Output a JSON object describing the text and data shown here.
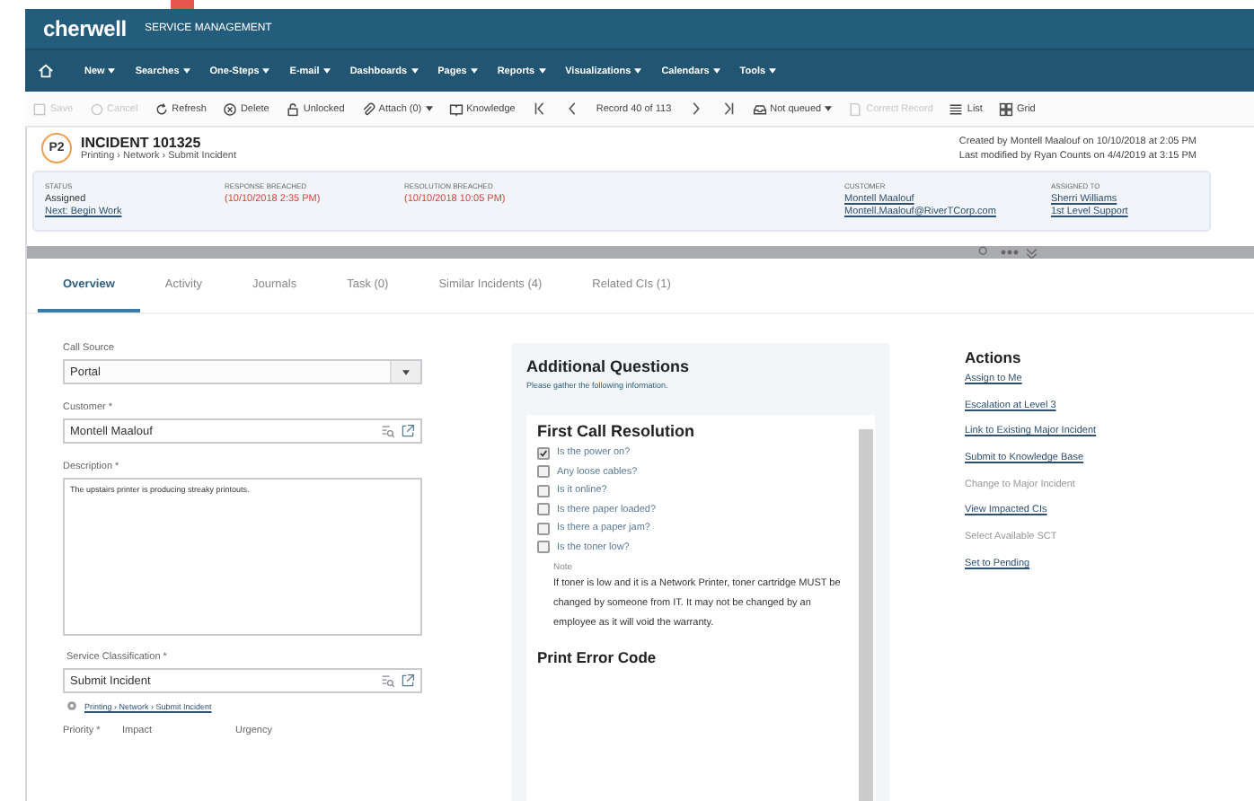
{
  "brand": {
    "logo": "cherwell",
    "product": "SERVICE MANAGEMENT"
  },
  "nav": [
    {
      "label": "New",
      "dropdown": true
    },
    {
      "label": "Searches",
      "dropdown": true
    },
    {
      "label": "One-Steps",
      "dropdown": true
    },
    {
      "label": "E-mail",
      "dropdown": true
    },
    {
      "label": "Dashboards",
      "dropdown": true
    },
    {
      "label": "Pages",
      "dropdown": true
    },
    {
      "label": "Reports",
      "dropdown": true
    },
    {
      "label": "Visualizations",
      "dropdown": true
    },
    {
      "label": "Calendars",
      "dropdown": true
    },
    {
      "label": "Tools",
      "dropdown": true
    }
  ],
  "toolbar": [
    {
      "kind": "button",
      "label": "Save",
      "disabled": true
    },
    {
      "kind": "button",
      "label": "Cancel",
      "disabled": true
    },
    {
      "kind": "button",
      "label": "Refresh",
      "disabled": false
    },
    {
      "kind": "button",
      "label": "Delete",
      "disabled": false
    },
    {
      "kind": "button",
      "label": "Unlocked",
      "disabled": false
    },
    {
      "kind": "button",
      "label": "Attach (0)",
      "disabled": false,
      "dropdown": true
    },
    {
      "kind": "button",
      "label": "Knowledge",
      "disabled": false
    },
    {
      "kind": "nav"
    },
    {
      "kind": "nav"
    },
    {
      "kind": "text",
      "label": "Record 40 of 113"
    },
    {
      "kind": "nav"
    },
    {
      "kind": "nav"
    },
    {
      "kind": "button",
      "label": "Not queued",
      "disabled": false,
      "dropdown": true
    },
    {
      "kind": "button",
      "label": "Correct Record",
      "disabled": true
    },
    {
      "kind": "button",
      "label": "List",
      "disabled": false
    },
    {
      "kind": "button",
      "label": "Grid",
      "disabled": false
    }
  ],
  "incident": {
    "priority": "P2",
    "title": "INCIDENT 101325",
    "breadcrumb": "Printing › Network › Submit Incident",
    "created": "Created by Montell Maalouf on 10/10/2018 at 2:05 PM",
    "modified": "Last modified by Ryan Counts on 4/4/2019 at 3:15 PM"
  },
  "summary": [
    {
      "label": "STATUS",
      "values": [
        {
          "kind": "text",
          "text": "Assigned"
        },
        {
          "kind": "link",
          "text": "Next: Begin Work"
        }
      ]
    },
    {
      "label": "RESPONSE BREACHED",
      "values": [
        {
          "kind": "alert",
          "text": "(10/10/2018 2:35 PM)"
        }
      ]
    },
    {
      "label": "RESOLUTION BREACHED",
      "values": [
        {
          "kind": "alert",
          "text": "(10/10/2018 10:05 PM)"
        }
      ]
    },
    {
      "label": "CUSTOMER",
      "values": [
        {
          "kind": "link",
          "text": "Montell Maalouf"
        },
        {
          "kind": "link",
          "text": "Montell.Maalouf@RiverTCorp.com"
        }
      ]
    },
    {
      "label": "ASSIGNED TO",
      "values": [
        {
          "kind": "link",
          "text": "Sherri Williams"
        },
        {
          "kind": "link",
          "text": "1st Level Support"
        }
      ]
    }
  ],
  "tabs": [
    {
      "label": "Overview",
      "selected": true
    },
    {
      "label": "Activity",
      "selected": false
    },
    {
      "label": "Journals",
      "selected": false
    },
    {
      "label": "Task (0)",
      "selected": false
    },
    {
      "label": "Similar Incidents (4)",
      "selected": false
    },
    {
      "label": "Related CIs (1)",
      "selected": false
    }
  ],
  "form": {
    "call_source": {
      "label": "Call Source",
      "value": "Portal"
    },
    "customer": {
      "label": "Customer *",
      "value": "Montell Maalouf"
    },
    "description": {
      "label": "Description *",
      "value": "The upstairs printer is producing streaky printouts."
    },
    "service_classification": {
      "label": "Service Classification *",
      "value": "Submit Incident",
      "link": "Printing › Network › Submit Incident"
    },
    "bottom_labels": [
      "Priority *",
      "Impact",
      "Urgency"
    ]
  },
  "questions": {
    "title": "Additional Questions",
    "subtitle": "Please gather the following information.",
    "section": "First Call Resolution",
    "items": [
      {
        "label": "Is the power on?",
        "checked": true
      },
      {
        "label": "Any loose cables?",
        "checked": false
      },
      {
        "label": "Is it online?",
        "checked": false
      },
      {
        "label": "Is there paper loaded?",
        "checked": false
      },
      {
        "label": "Is there a paper jam?",
        "checked": false
      },
      {
        "label": "Is the toner low?",
        "checked": false
      }
    ],
    "note_label": "Note",
    "note": "If toner is low and it is a Network Printer, toner cartridge MUST be changed by someone from IT. It may not be changed by an employee as it will void the warranty.",
    "next_section": "Print Error Code"
  },
  "actions": {
    "title": "Actions",
    "items": [
      {
        "label": "Assign to Me",
        "disabled": false
      },
      {
        "label": "Escalation at Level 3",
        "disabled": false
      },
      {
        "label": "Link to Existing Major Incident",
        "disabled": false
      },
      {
        "label": "Submit to Knowledge Base",
        "disabled": false
      },
      {
        "label": "Change to Major Incident",
        "disabled": true
      },
      {
        "label": "View Impacted CIs",
        "disabled": false
      },
      {
        "label": "Select Available SCT",
        "disabled": true
      },
      {
        "label": "Set to Pending",
        "disabled": false
      }
    ]
  }
}
